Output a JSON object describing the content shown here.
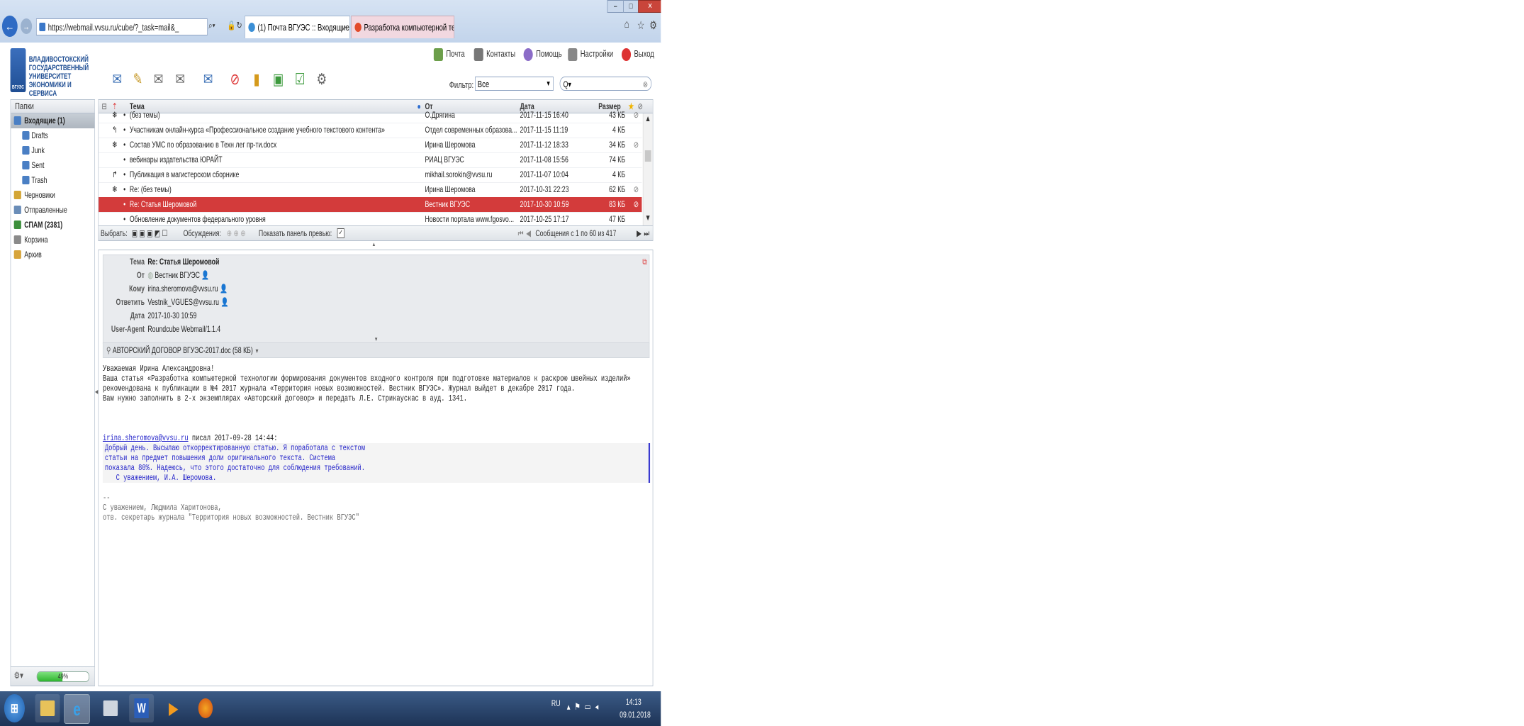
{
  "browser": {
    "url": "https://webmail.vvsu.ru/cube/?_task=mail&_",
    "tabs": [
      {
        "label": "(1) Почта ВГУЭС :: Входящие",
        "close": "×"
      },
      {
        "label": "Разработка компьютерной те...",
        "close": ""
      }
    ],
    "window_buttons": {
      "min": "–",
      "max": "□",
      "close": "✕"
    }
  },
  "logo": {
    "lines": [
      "ВЛАДИВОСТОКСКИЙ",
      "ГОСУДАРСТВЕННЫЙ",
      "УНИВЕРСИТЕТ",
      "ЭКОНОМИКИ И СЕРВИСА"
    ],
    "badge": "ВГУЭС"
  },
  "topnav": [
    {
      "label": "Почта",
      "icon": "mail-icon"
    },
    {
      "label": "Контакты",
      "icon": "contacts-icon"
    },
    {
      "label": "Помощь",
      "icon": "help-icon"
    },
    {
      "label": "Настройки",
      "icon": "settings-icon"
    },
    {
      "label": "Выход",
      "icon": "logout-icon"
    }
  ],
  "filter": {
    "label": "Фильтр:",
    "value": "Все",
    "search_placeholder": "Q▾"
  },
  "folders": {
    "header": "Папки",
    "items": [
      {
        "label": "Входящие (1)",
        "selected": true,
        "sub": false
      },
      {
        "label": "Drafts",
        "sub": true
      },
      {
        "label": "Junk",
        "sub": true
      },
      {
        "label": "Sent",
        "sub": true
      },
      {
        "label": "Trash",
        "sub": true
      },
      {
        "label": "Черновики",
        "sub": false
      },
      {
        "label": "Отправленные",
        "sub": false
      },
      {
        "label": "СПАМ (2381)",
        "sub": false,
        "bold": true
      },
      {
        "label": "Корзина",
        "sub": false
      },
      {
        "label": "Архив",
        "sub": false
      }
    ],
    "quota": "49%",
    "quota_value": 0.49
  },
  "list": {
    "columns": {
      "subject": "Тема",
      "from": "От",
      "date": "Дата",
      "size": "Размер"
    },
    "rows": [
      {
        "subject": "(без темы)",
        "from": "О.Дрягина",
        "date": "2017-11-15 16:40",
        "size": "43 КБ",
        "thread": "❄",
        "attach": true
      },
      {
        "subject": "Участникам онлайн-курса «Профессиональное создание учебного текстового контента»",
        "from": "Отдел современных образова...",
        "date": "2017-11-15 11:19",
        "size": "4 КБ",
        "thread": "↰",
        "attach": false
      },
      {
        "subject": "Состав УМС по образованию в Техн лег пр-ти.docx",
        "from": "Ирина Шеромова",
        "date": "2017-11-12 18:33",
        "size": "34 КБ",
        "thread": "❄",
        "attach": true
      },
      {
        "subject": "вебинары издательства ЮРАЙТ",
        "from": "РИАЦ ВГУЭС",
        "date": "2017-11-08 15:56",
        "size": "74 КБ",
        "thread": "",
        "attach": false
      },
      {
        "subject": "Публикация в магистерском сборнике",
        "from": "mikhail.sorokin@vvsu.ru",
        "date": "2017-11-07 10:04",
        "size": "4 КБ",
        "thread": "↱",
        "attach": false
      },
      {
        "subject": "Re: (без темы)",
        "from": "Ирина Шеромова",
        "date": "2017-10-31 22:23",
        "size": "62 КБ",
        "thread": "❄",
        "attach": true
      },
      {
        "subject": "Re: Статья Шеромовой",
        "from": "Вестник ВГУЭС",
        "date": "2017-10-30 10:59",
        "size": "83 КБ",
        "thread": "",
        "attach": true,
        "selected": true
      },
      {
        "subject": "Обновление документов федерального уровня",
        "from": "Новости портала www.fgosvo...",
        "date": "2017-10-25 17:17",
        "size": "47 КБ",
        "thread": "",
        "attach": false
      }
    ],
    "footer": {
      "select_label": "Выбрать:",
      "threads_label": "Обсуждения:",
      "preview_label": "Показать панель превью:",
      "count": "Сообщения с 1 по 60 из 417"
    }
  },
  "message": {
    "headers": [
      {
        "label": "Тема",
        "value": "Re: Статья Шеромовой"
      },
      {
        "label": "От",
        "value": "Вестник ВГУЭС"
      },
      {
        "label": "Кому",
        "value": "irina.sheromova@vvsu.ru"
      },
      {
        "label": "Ответить",
        "value": "Vestnik_VGUES@vvsu.ru"
      },
      {
        "label": "Дата",
        "value": "2017-10-30 10:59"
      },
      {
        "label": "User-Agent",
        "value": "Roundcube Webmail/1.1.4"
      }
    ],
    "attachment": "АВТОРСКИЙ ДОГОВОР ВГУЭС-2017.doc (58 КБ)",
    "body": [
      "Уважаемая Ирина Александровна!",
      "",
      "Ваша статья «Разработка компьютерной технологии формирования документов входного контроля при подготовке материалов к раскрою швейных изделий»",
      "рекомендована к публикации в №4 2017 журнала «Территория новых возможностей. Вестник ВГУЭС». Журнал выйдет в декабре 2017 года.",
      "",
      "Вам нужно заполнить в 2-х экземплярах «Авторский договор» и передать Л.Е. Стрикаускас в ауд. 1341."
    ],
    "quote_intro_email": "irina.sheromova@vvsu.ru",
    "quote_intro_rest": " писал 2017-09-28 14:44:",
    "quote": [
      "Добрый день. Высылаю откорректированную статью. Я поработала с текстом",
      "статьи на предмет повышения доли оригинального текста. Система",
      "показала 80%. Надеюсь, что этого достаточно для соблюдения требований.",
      "   С уважением, И.А. Шеромова."
    ],
    "signature": [
      "--",
      "С уважением, Людмила Харитонова,",
      "отв. секретарь журнала \"Территория новых возможностей. Вестник ВГУЭС\""
    ]
  },
  "taskbar": {
    "lang": "RU",
    "time": "14:13",
    "date": "09.01.2018"
  }
}
